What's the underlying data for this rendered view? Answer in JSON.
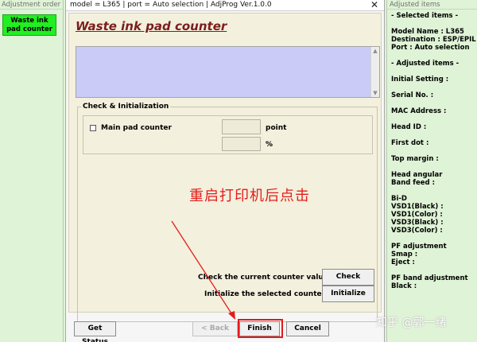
{
  "left_panel": {
    "title": "Adjustment order",
    "selected_item": "Waste ink pad counter"
  },
  "dialog": {
    "title": "model = L365 | port = Auto selection | AdjProg Ver.1.0.0",
    "close_symbol": "✕",
    "heading": "Waste ink pad counter",
    "group_title": "Check & Initialization",
    "main_pad_label": "Main pad counter",
    "unit_point": "point",
    "unit_percent": "%",
    "check_label": "Check the current counter value. -->",
    "initialize_label": "Initialize the selected counters. -->",
    "check_button": "Check",
    "initialize_button": "Initialize",
    "get_status_button": "Get Status",
    "back_button": "< Back",
    "finish_button": "Finish",
    "cancel_button": "Cancel"
  },
  "annotation": {
    "text": "重启打印机后点击",
    "color": "#e31d1d"
  },
  "right_panel": {
    "title": "Adjusted items",
    "lines": [
      "- Selected items -",
      "Model Name : L365",
      "Destination : ESP/EPIL",
      "Port : Auto selection",
      "- Adjusted items -",
      "Initial Setting :",
      "Serial No. :",
      "MAC Address :",
      "Head ID :",
      "First dot :",
      "Top margin :",
      "Head angular",
      " Band feed :",
      "Bi-D",
      " VSD1(Black) :",
      " VSD1(Color) :",
      " VSD3(Black) :",
      " VSD3(Color) :",
      "PF adjustment",
      "Smap :",
      "Eject :",
      "PF band adjustment",
      "Black :"
    ]
  },
  "watermark": "知乎 @郭一绪",
  "colors": {
    "panel_green": "#dff3d6",
    "selected_green": "#22ee22",
    "heading_maroon": "#7b1d1d",
    "lavender": "#cbcbf8",
    "highlight_red": "#e21a1a"
  }
}
